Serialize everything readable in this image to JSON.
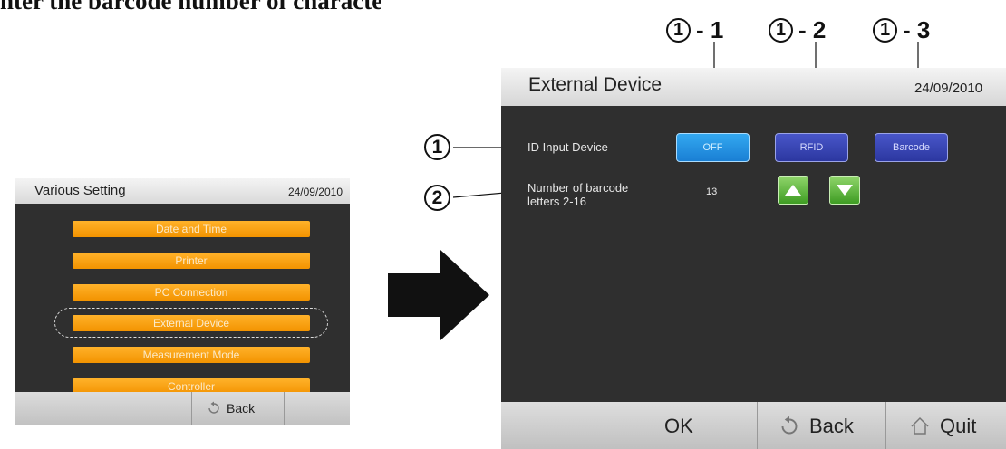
{
  "heading": "nter the barcode number of characters.",
  "callouts": {
    "top": [
      {
        "num": "1",
        "suffix": "- 1"
      },
      {
        "num": "1",
        "suffix": "- 2"
      },
      {
        "num": "1",
        "suffix": "- 3"
      }
    ],
    "side": [
      {
        "num": "1"
      },
      {
        "num": "2"
      }
    ]
  },
  "left_screen": {
    "title": "Various Setting",
    "date": "24/09/2010",
    "menu": [
      "Date and Time",
      "Printer",
      "PC Connection",
      "External Device",
      "Measurement Mode",
      "Controller"
    ],
    "selected_index": 3,
    "back_label": "Back"
  },
  "right_screen": {
    "title": "External Device",
    "date": "24/09/2010",
    "id_input_label": "ID Input Device",
    "devices": [
      "OFF",
      "RFID",
      "Barcode"
    ],
    "selected_device": "OFF",
    "barcode_label_line1": "Number of barcode",
    "barcode_label_line2": "letters 2-16",
    "barcode_count": "13",
    "bottom": {
      "ok_label": "OK",
      "back_label": "Back",
      "quit_label": "Quit"
    }
  },
  "colors": {
    "menu_orange": "#f6a21a",
    "device_selected": "#2a96e6",
    "device_unselected": "#3a47b5",
    "stepper_green": "#5bb53a",
    "screen_bg": "#2f2f2f"
  },
  "icons": [
    "back-icon",
    "home-icon",
    "arrow-up-icon",
    "arrow-down-icon",
    "right-arrow-icon"
  ]
}
